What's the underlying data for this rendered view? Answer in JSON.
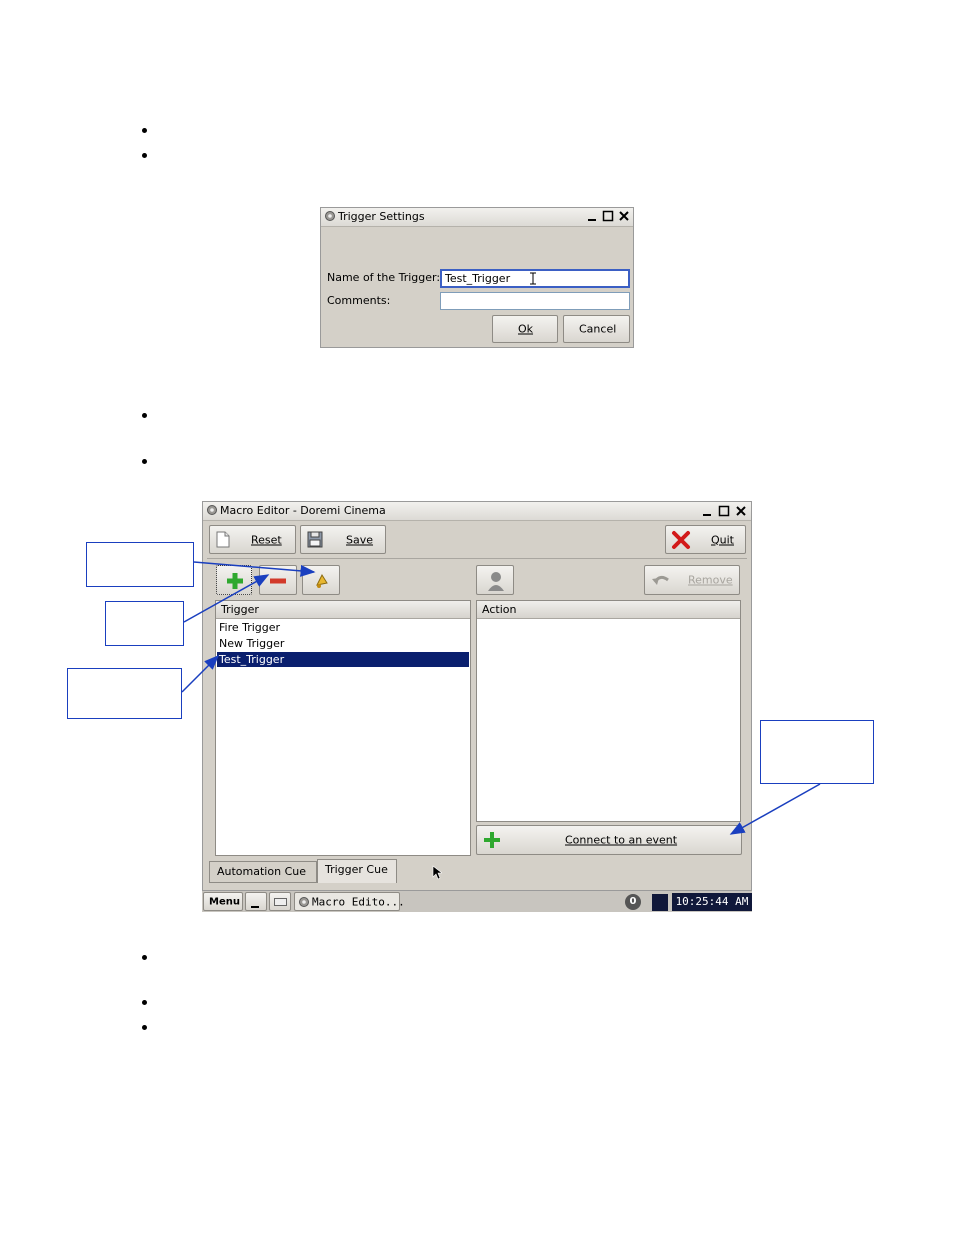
{
  "trigger_settings": {
    "title": "Trigger Settings",
    "name_label": "Name of the Trigger:",
    "name_value": "Test_Trigger",
    "comments_label": "Comments:",
    "comments_value": "",
    "ok_label": "Ok",
    "cancel_label": "Cancel"
  },
  "macro_editor": {
    "title": "Macro Editor - Doremi Cinema",
    "toolbar": {
      "reset_label": "Reset",
      "save_label": "Save",
      "quit_label": "Quit"
    },
    "remove_label": "Remove",
    "trigger_list": {
      "header": "Trigger",
      "items": [
        "Fire Trigger",
        "New Trigger",
        "Test_Trigger"
      ],
      "selected_index": 2
    },
    "action_list": {
      "header": "Action"
    },
    "connect_label": "Connect to an event",
    "tabs": [
      "Automation Cue",
      "Trigger Cue"
    ],
    "active_tab": 1
  },
  "taskbar": {
    "menu_label": "Menu",
    "task_label": "Macro Edito...",
    "badge": "0",
    "clock": "10:25:44 AM"
  },
  "colors": {
    "selection": "#0a1f6e",
    "callout_border": "#1a3fbf",
    "window_bg": "#d4d0c8"
  }
}
